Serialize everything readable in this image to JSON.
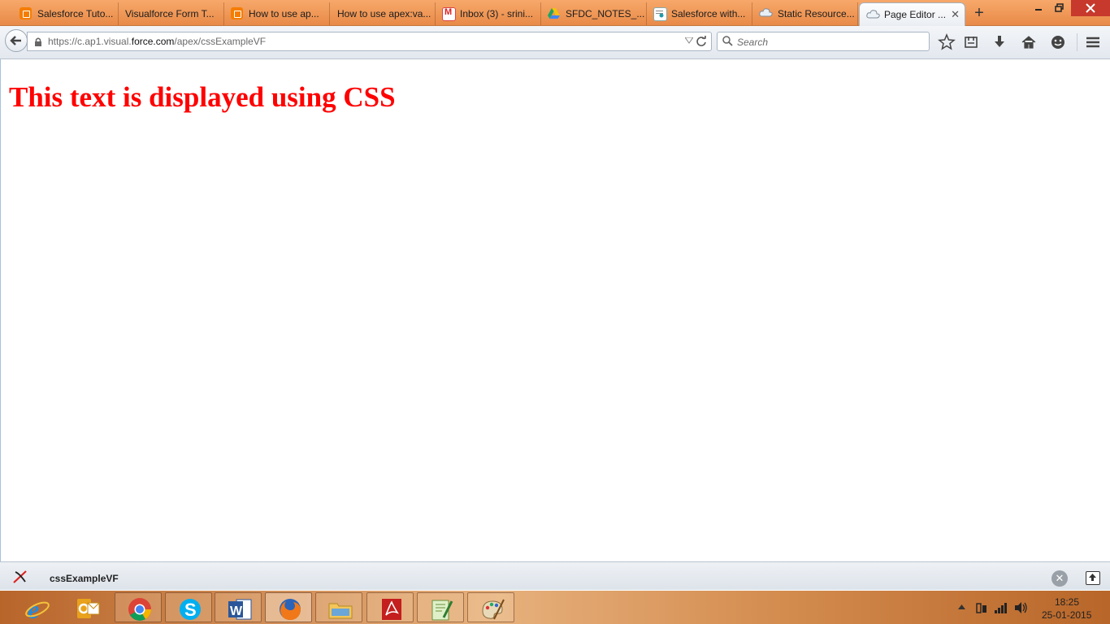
{
  "browser": {
    "tabs": [
      {
        "label": "Salesforce Tuto...",
        "icon": "blogger-icon"
      },
      {
        "label": "Visualforce Form T...",
        "icon": ""
      },
      {
        "label": "How to use ap...",
        "icon": "blogger-icon"
      },
      {
        "label": "How to use apex:va...",
        "icon": ""
      },
      {
        "label": "Inbox (3) - srini...",
        "icon": "gmail-icon"
      },
      {
        "label": "SFDC_NOTES_...",
        "icon": "google-drive-icon"
      },
      {
        "label": "Salesforce with...",
        "icon": "salesforce-page-icon"
      },
      {
        "label": "Static Resource...",
        "icon": "cloud-icon"
      },
      {
        "label": "Page Editor ...",
        "icon": "cloud-icon",
        "active": true
      }
    ],
    "url": {
      "prefix": "https://c.ap1.visual.",
      "domain": "force.com",
      "path": "/apex/cssExampleVF"
    },
    "search_placeholder": "Search",
    "accent_color": "#e88a48"
  },
  "page": {
    "heading": "This text is displayed using CSS",
    "heading_color": "#ff0000"
  },
  "dev_footer": {
    "page_name": "cssExampleVF"
  },
  "taskbar": {
    "apps": [
      "internet-explorer-icon",
      "outlook-icon",
      "chrome-icon",
      "skype-icon",
      "word-icon",
      "firefox-icon",
      "file-explorer-icon",
      "acrobat-icon",
      "notepad-plus-plus-icon",
      "paint-icon"
    ],
    "clock_time": "18:25",
    "clock_date": "25-01-2015"
  }
}
